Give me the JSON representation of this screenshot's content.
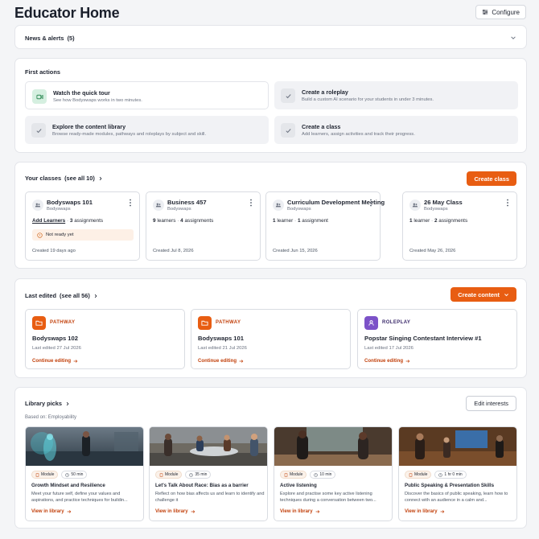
{
  "header": {
    "title": "Educator Home",
    "configure_label": "Configure"
  },
  "news": {
    "title": "News & alerts",
    "count": "(5)"
  },
  "first_actions": {
    "title": "First actions",
    "items": [
      {
        "title": "Watch the quick tour",
        "desc": "See how Bodyswaps works in two minutes.",
        "status": "active",
        "icon": "video-icon"
      },
      {
        "title": "Create a roleplay",
        "desc": "Build a custom AI scenario for your students in under 3 minutes.",
        "status": "done",
        "icon": "check-icon"
      },
      {
        "title": "Explore the content library",
        "desc": "Browse ready-made modules, pathways and roleplays by subject and skill.",
        "status": "done",
        "icon": "check-icon"
      },
      {
        "title": "Create a class",
        "desc": "Add learners, assign activities and track their progress.",
        "status": "done",
        "icon": "check-icon"
      }
    ]
  },
  "classes": {
    "title": "Your classes",
    "see_all": "(see all 10)",
    "create_label": "Create class",
    "items": [
      {
        "name": "Bodyswaps 101",
        "org": "Bodyswaps",
        "learners": "Add Learners",
        "learners_link": true,
        "assignments_num": "3",
        "assignments_word": "assignments",
        "warning": "Not ready yet",
        "created": "Created 19 days ago"
      },
      {
        "name": "Business 457",
        "org": "Bodyswaps",
        "learners_num": "9",
        "learners_word": "learners",
        "assignments_num": "4",
        "assignments_word": "assignments",
        "created": "Created Jul 8, 2026"
      },
      {
        "name": "Curriculum Development Meeting",
        "org": "Bodyswaps",
        "learners_num": "1",
        "learners_word": "learner",
        "assignments_num": "1",
        "assignments_word": "assignment",
        "created": "Created Jun 15, 2026"
      },
      {
        "name": "26 May Class",
        "org": "Bodyswaps",
        "learners_num": "1",
        "learners_word": "learner",
        "assignments_num": "2",
        "assignments_word": "assignments",
        "created": "Created May 26, 2026"
      }
    ]
  },
  "last_edited": {
    "title": "Last edited",
    "see_all": "(see all 56)",
    "create_label": "Create content",
    "items": [
      {
        "type": "PATHWAY",
        "name": "Bodyswaps 102",
        "edited": "Last edited 27 Jul 2026",
        "action": "Continue editing",
        "color": "#e85d12"
      },
      {
        "type": "PATHWAY",
        "name": "Bodyswaps 101",
        "edited": "Last edited 21 Jul 2026",
        "action": "Continue editing",
        "color": "#e85d12"
      },
      {
        "type": "ROLEPLAY",
        "name": "Popstar Singing Contestant Interview #1",
        "edited": "Last edited 17 Jul 2026",
        "action": "Continue editing",
        "color": "#7c52c8"
      }
    ]
  },
  "library": {
    "title": "Library picks",
    "based_on": "Based on: Employability",
    "edit_label": "Edit interests",
    "items": [
      {
        "badge": "Module",
        "duration": "50 min",
        "name": "Growth Mindset and Resilience",
        "desc": "Meet your future self, define your values and aspirations, and practice techniques for buildin...",
        "action": "View in library",
        "thumb": "scifi"
      },
      {
        "badge": "Module",
        "duration": "35 min",
        "name": "Let's Talk About Race: Bias as a barrier",
        "desc": "Reflect on how bias affects us and learn to identify and challenge it",
        "action": "View in library",
        "thumb": "meeting"
      },
      {
        "badge": "Module",
        "duration": "10 min",
        "name": "Active listening",
        "desc": "Explore and practise some key active listening techniques during a conversation between two...",
        "action": "View in library",
        "thumb": "office"
      },
      {
        "badge": "Module",
        "duration": "1 hr 0 min",
        "name": "Public Speaking & Presentation Skills",
        "desc": "Discover the basics of public speaking, learn how to connect with an audience in a calm and...",
        "action": "View in library",
        "thumb": "stage"
      }
    ]
  },
  "colors": {
    "accent": "#e85d12",
    "link": "#c2410c",
    "roleplay": "#7c52c8",
    "done_bg": "#f1f2f5",
    "tour_icon_bg": "#d5efe0"
  }
}
